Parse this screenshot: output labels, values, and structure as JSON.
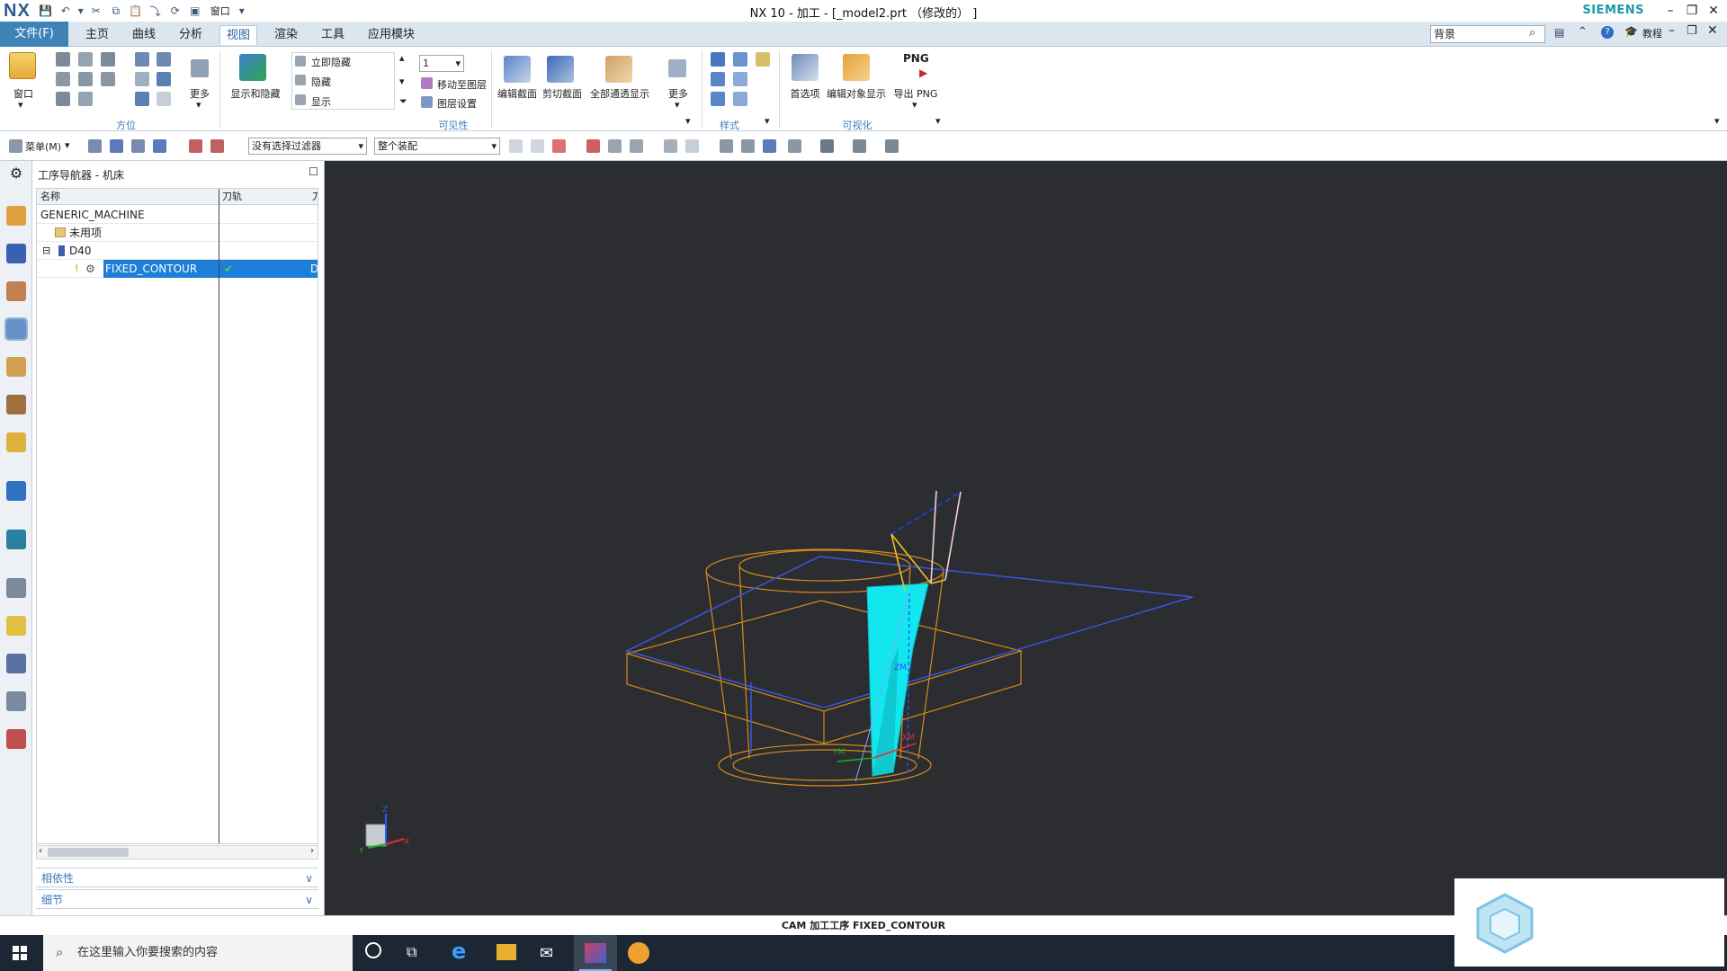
{
  "app": {
    "logo": "NX",
    "window_title": "NX 10 - 加工 - [_model2.prt （修改的） ]",
    "brand": "SIEMENS"
  },
  "tabs": [
    {
      "label": "文件(F)"
    },
    {
      "label": "主页"
    },
    {
      "label": "曲线"
    },
    {
      "label": "分析"
    },
    {
      "label": "视图"
    },
    {
      "label": "渲染"
    },
    {
      "label": "工具"
    },
    {
      "label": "应用模块"
    }
  ],
  "active_tab": "视图",
  "search": {
    "value": "背景"
  },
  "tutorial_label": "教程",
  "ribbon": {
    "window_label": "窗口",
    "more1": "更多",
    "group_orientation": "方位",
    "show_hide": "显示和隐藏",
    "immediate_hide": "立即隐藏",
    "hide": "隐藏",
    "show": "显示",
    "layer_value": "1",
    "move_to_layer": "移动至图层",
    "layer_settings": "图层设置",
    "group_visibility": "可见性",
    "edit_section": "编辑截面",
    "clip_section": "剪切截面",
    "show_all_through": "全部通透显示",
    "more2": "更多",
    "group_style": "样式",
    "preferences": "首选项",
    "edit_object_display": "编辑对象显示",
    "export_png": "导出 PNG",
    "png_badge": "PNG",
    "group_visualization": "可视化"
  },
  "toolbar2": {
    "menu_label": "菜单(M)",
    "filter_value": "没有选择过滤器",
    "assembly_value": "整个装配"
  },
  "navigator": {
    "title": "工序导航器 - 机床",
    "col_name": "名称",
    "col_toolpath": "刀轨",
    "col_tool": "刀",
    "rows": [
      {
        "label": "GENERIC_MACHINE"
      },
      {
        "label": "未用项"
      },
      {
        "label": "D40"
      },
      {
        "label": "FIXED_CONTOUR",
        "tool_cut": "D"
      }
    ],
    "panel_dependencies": "相依性",
    "panel_details": "细节"
  },
  "viewport": {
    "triad_labels": {
      "z": "Z",
      "y": "Y",
      "x": "X"
    },
    "part_labels": {
      "zm": "ZM",
      "ym": "YM",
      "xm": "XM"
    }
  },
  "status_bar": {
    "text": "CAM 加工工序 FIXED_CONTOUR"
  },
  "taskbar": {
    "search_placeholder": "在这里输入你要搜索的内容"
  }
}
